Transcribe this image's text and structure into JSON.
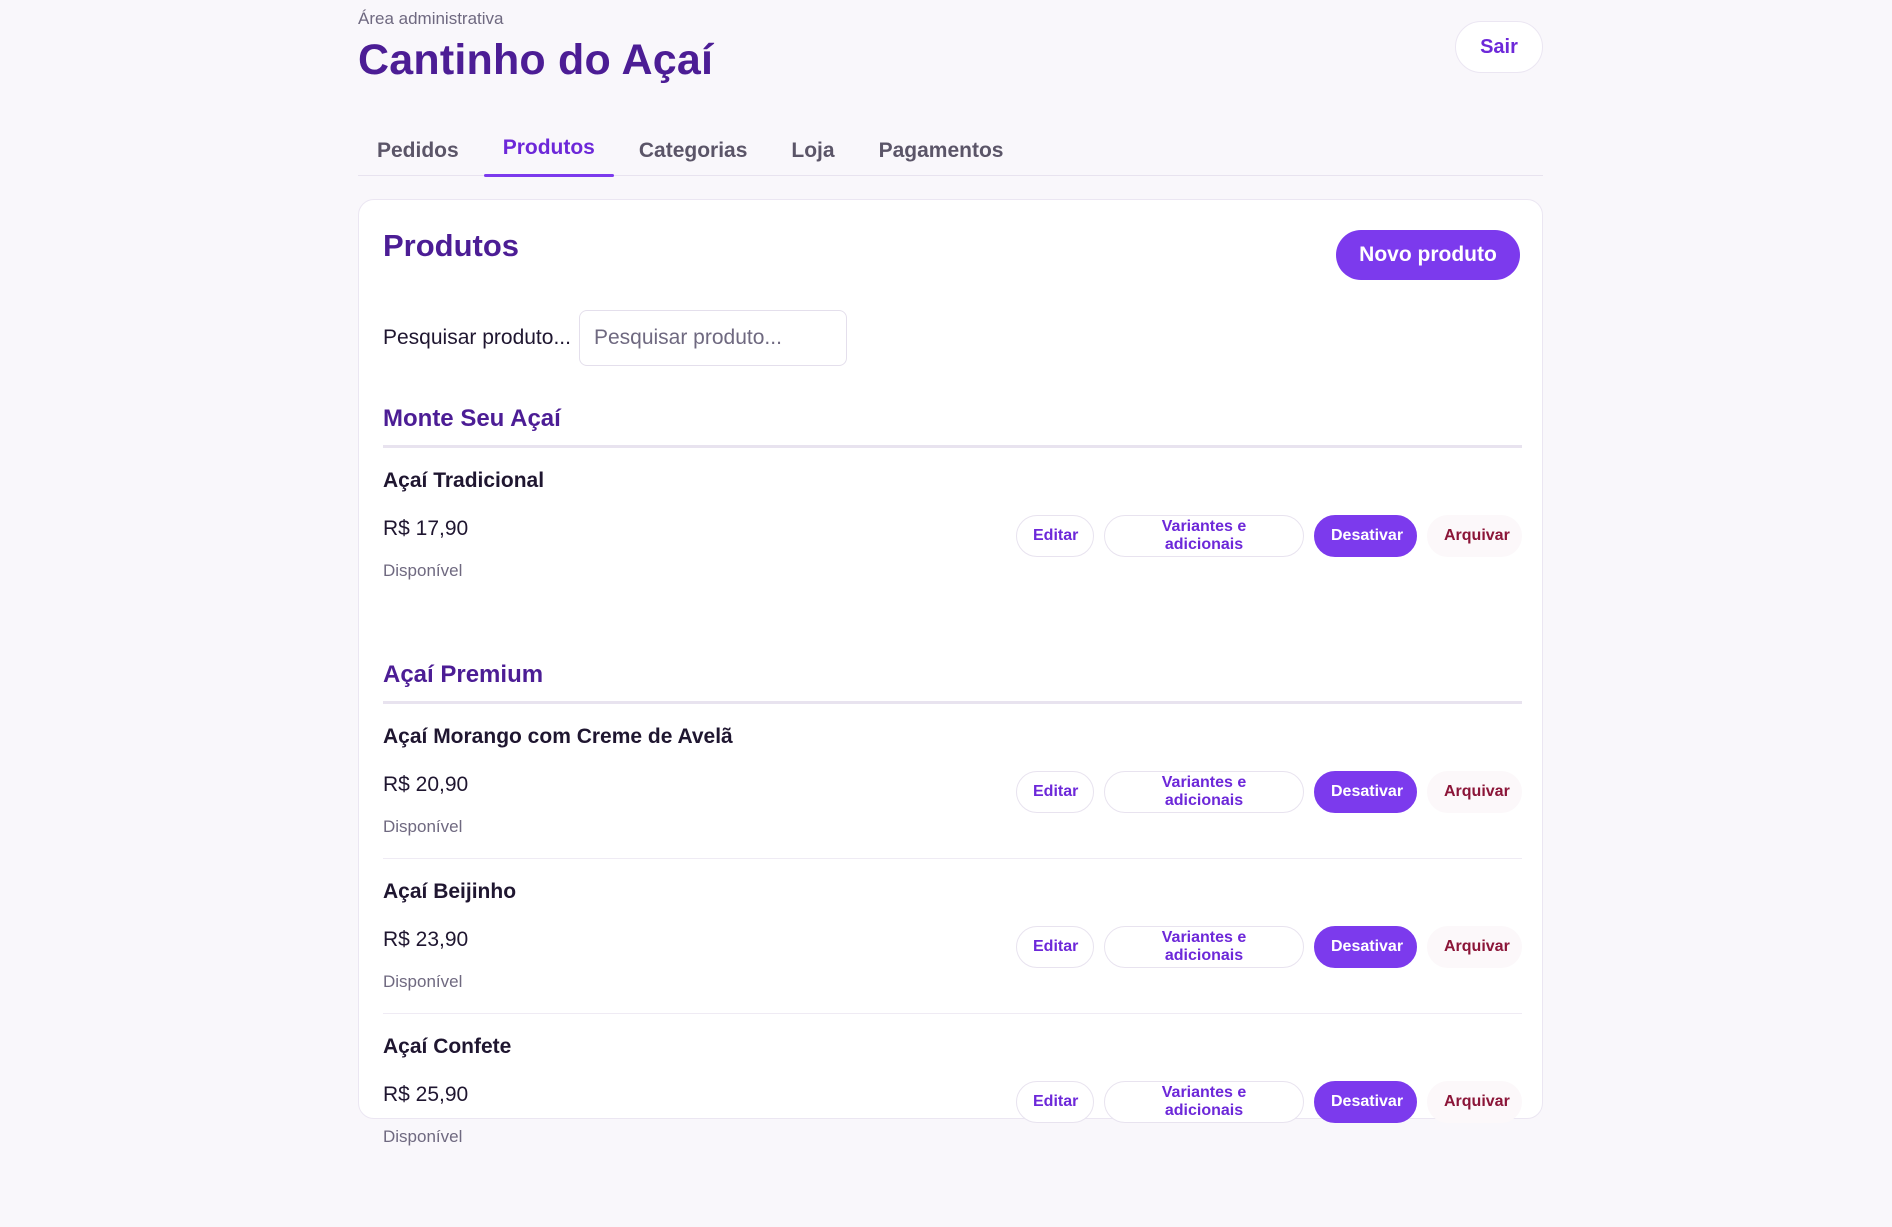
{
  "header": {
    "eyebrow": "Área administrativa",
    "title": "Cantinho do Açaí",
    "logout_label": "Sair"
  },
  "tabs": [
    {
      "label": "Pedidos",
      "active": false
    },
    {
      "label": "Produtos",
      "active": true
    },
    {
      "label": "Categorias",
      "active": false
    },
    {
      "label": "Loja",
      "active": false
    },
    {
      "label": "Pagamentos",
      "active": false
    }
  ],
  "main": {
    "title": "Produtos",
    "new_product_label": "Novo produto",
    "search": {
      "label": "Pesquisar produto...",
      "placeholder": "Pesquisar produto...",
      "value": ""
    },
    "actions": {
      "edit": "Editar",
      "variants": "Variantes e adicionais",
      "deactivate": "Desativar",
      "archive": "Arquivar"
    },
    "categories": [
      {
        "name": "Monte Seu Açaí",
        "products": [
          {
            "name": "Açaí Tradicional",
            "price": "R$ 17,90",
            "status": "Disponível"
          }
        ]
      },
      {
        "name": "Açaí Premium",
        "products": [
          {
            "name": "Açaí Morango com Creme de Avelã",
            "price": "R$ 20,90",
            "status": "Disponível"
          },
          {
            "name": "Açaí Beijinho",
            "price": "R$ 23,90",
            "status": "Disponível"
          },
          {
            "name": "Açaí Confete",
            "price": "R$ 25,90",
            "status": "Disponível"
          }
        ]
      }
    ]
  },
  "colors": {
    "brand": "#4c1d95",
    "accent": "#7c3aed",
    "archive": "#8b1538"
  }
}
